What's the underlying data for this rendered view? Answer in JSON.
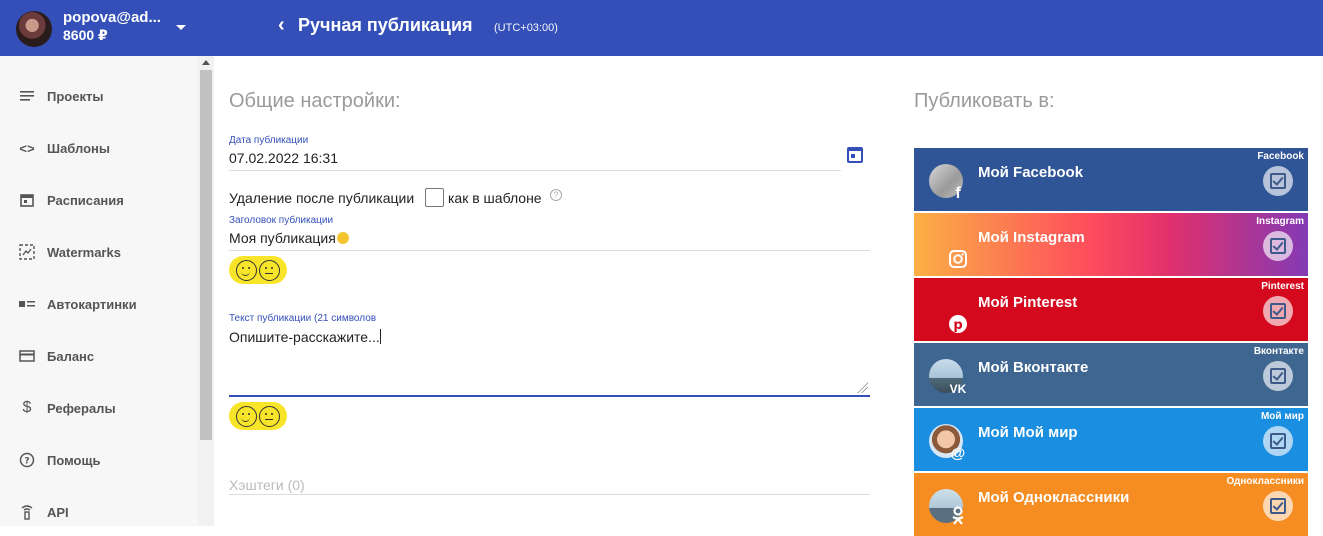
{
  "header": {
    "user_name": "popova@ad...",
    "balance": "8600 ₽",
    "page_title": "Ручная публикация",
    "timezone": "(UTC+03:00)"
  },
  "sidebar": {
    "items": [
      {
        "label": "Проекты",
        "icon": "list-icon"
      },
      {
        "label": "Шаблоны",
        "icon": "code-icon"
      },
      {
        "label": "Расписания",
        "icon": "calendar-icon"
      },
      {
        "label": "Watermarks",
        "icon": "watermark-icon"
      },
      {
        "label": "Автокартинки",
        "icon": "image-list-icon"
      },
      {
        "label": "Баланс",
        "icon": "card-icon"
      },
      {
        "label": "Рефералы",
        "icon": "dollar-icon"
      },
      {
        "label": "Помощь",
        "icon": "help-circle-icon"
      },
      {
        "label": "API",
        "icon": "api-icon"
      }
    ]
  },
  "form": {
    "section_title": "Общие настройки:",
    "date": {
      "label": "Дата публикации",
      "value": "07.02.2022 16:31"
    },
    "delete_after": {
      "label": "Удаление после публикации",
      "suffix": "как в шаблоне"
    },
    "post_title": {
      "label": "Заголовок публикации",
      "value": "Моя публикация"
    },
    "post_text": {
      "label": "Текст публикации (21 символов",
      "value": "Опишите-расскажите..."
    },
    "hashtags": {
      "placeholder": "Хэштеги (0)"
    }
  },
  "publish": {
    "title": "Публиковать в:",
    "cards": [
      {
        "name": "Мой Facebook",
        "network": "Facebook",
        "checked": true,
        "color": "#3b5998"
      },
      {
        "name": "Мой Instagram",
        "network": "Instagram",
        "checked": true,
        "color": "#e1306c"
      },
      {
        "name": "Мой Pinterest",
        "network": "Pinterest",
        "checked": true,
        "color": "#e60023"
      },
      {
        "name": "Мой Вконтакте",
        "network": "Вконтакте",
        "checked": true,
        "color": "#45668e"
      },
      {
        "name": "Мой Мой мир",
        "network": "Мой мир",
        "checked": true,
        "color": "#168de2"
      },
      {
        "name": "Мой Одноклассники",
        "network": "Одноклассники",
        "checked": true,
        "color": "#f7931e"
      }
    ]
  }
}
